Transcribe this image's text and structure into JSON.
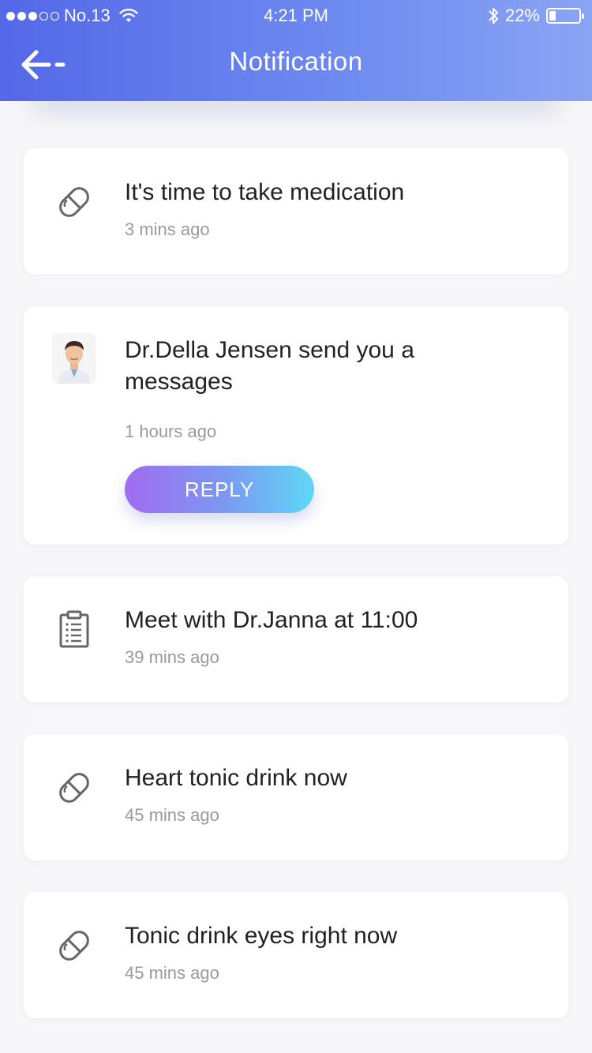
{
  "status_bar": {
    "carrier": "No.13",
    "time": "4:21 PM",
    "battery": "22%",
    "battery_level": 0.22,
    "icons": [
      "signal-dots",
      "wifi-icon",
      "bluetooth-icon",
      "battery-icon"
    ]
  },
  "header": {
    "title": "Notification",
    "back_icon": "back-arrow-icon",
    "gradient": [
      "#5468e8",
      "#8aa4f4"
    ]
  },
  "notifications": [
    {
      "icon": "pill-icon",
      "title": "It's time to take medication",
      "time": "3 mins ago"
    },
    {
      "icon": "doctor-avatar",
      "title": "Dr.Della Jensen send you a messages",
      "time": "1 hours ago",
      "action": "REPLY"
    },
    {
      "icon": "clipboard-icon",
      "title": "Meet with Dr.Janna at 11:00",
      "time": "39 mins ago"
    },
    {
      "icon": "pill-icon",
      "title": "Heart tonic drink now",
      "time": "45 mins ago"
    },
    {
      "icon": "pill-icon",
      "title": "Tonic drink eyes right now",
      "time": "45 mins ago"
    }
  ],
  "colors": {
    "accent_start": "#a06bf0",
    "accent_end": "#5fd8f6",
    "time_text": "#9a9a9a"
  }
}
